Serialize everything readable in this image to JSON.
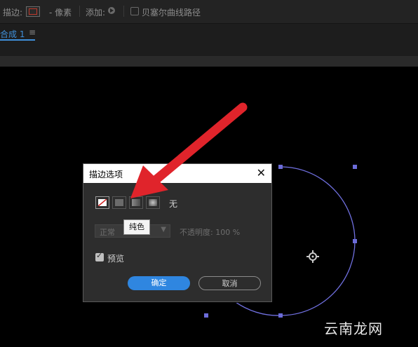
{
  "toolbar": {
    "stroke_label": "描边:",
    "pixels_label": "- 像素",
    "add_label": "添加:",
    "bezier_label": "贝塞尔曲线路径"
  },
  "tab": {
    "label": "合成 1",
    "menu_icon": "≡"
  },
  "dialog": {
    "title": "描边选项",
    "close": "✕",
    "none_label": "无",
    "blend_mode": "正常",
    "opacity_label": "不透明度: 100 %",
    "tooltip": "纯色",
    "preview_label": "预览",
    "ok_label": "确定",
    "cancel_label": "取消"
  },
  "colors": {
    "accent": "#2f86e0",
    "arrow": "#e0242b",
    "path": "#7070e0"
  },
  "watermark": "云南龙网"
}
